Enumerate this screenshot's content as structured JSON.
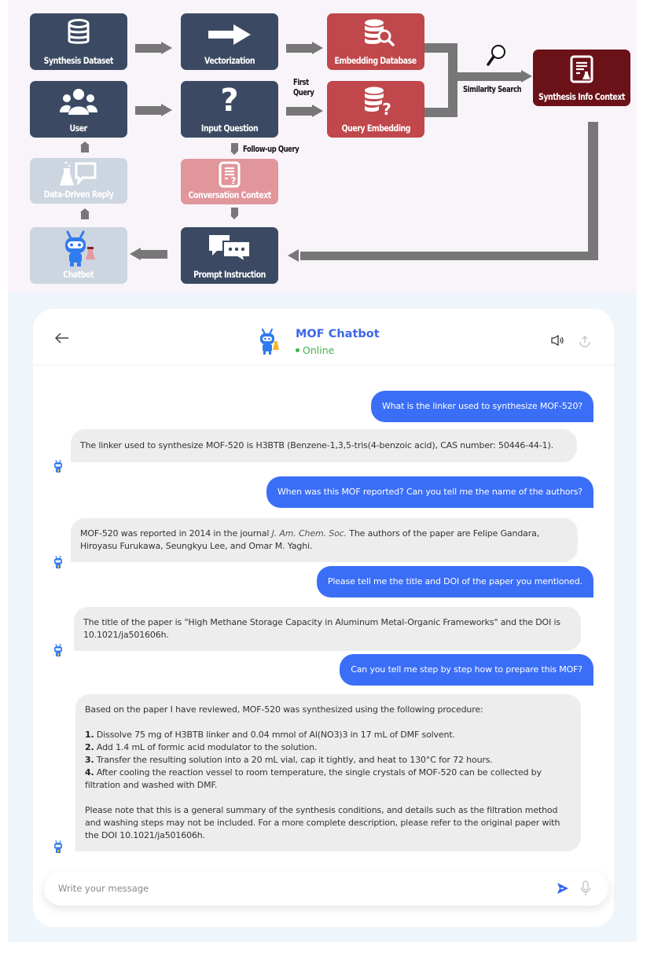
{
  "diagram": {
    "boxes": {
      "synthesis_dataset": "Synthesis Dataset",
      "vectorization": "Vectorization",
      "embedding_database": "Embedding Database",
      "user": "User",
      "input_question": "Input Question",
      "query_embedding": "Query Embedding",
      "synthesis_info_context": "Synthesis Info Context",
      "data_driven_reply": "Data-Driven Reply",
      "conversation_context": "Conversation Context",
      "chatbot": "Chatbot",
      "prompt_instruction": "Prompt Instruction"
    },
    "labels": {
      "first_query_line1": "First",
      "first_query_line2": "Query",
      "similarity_search": "Similarity Search",
      "follow_up_query": "Follow-up Query"
    },
    "colors": {
      "navy": "#3b4a62",
      "red": "#c0474b",
      "maroon": "#6b1118",
      "pale": "#cdd5e0",
      "pink": "#e0969b",
      "connector": "#777777"
    }
  },
  "chat": {
    "header": {
      "back_icon": "arrow-left-icon",
      "title": "MOF Chatbot",
      "status": "Online",
      "speaker_icon": "speaker-icon",
      "upload_icon": "upload-icon"
    },
    "messages": [
      {
        "role": "user",
        "text": "What is the linker used to synthesize MOF-520?"
      },
      {
        "role": "bot",
        "text": "The linker used to synthesize MOF-520 is H3BTB (Benzene-1,3,5-tris(4-benzoic acid), CAS number: 50446-44-1)."
      },
      {
        "role": "user",
        "text": "When was this MOF reported? Can you tell me the name of the authors?"
      },
      {
        "role": "bot",
        "text_before": "MOF-520 was reported in 2014 in the journal ",
        "journal": "J. Am. Chem. Soc.",
        "text_after": " The authors of the paper are Felipe Gandara, Hiroyasu Furukawa, Seungkyu Lee, and Omar M. Yaghi."
      },
      {
        "role": "user",
        "text": "Please tell me the title and DOI of the paper you mentioned."
      },
      {
        "role": "bot",
        "text": "The title of the paper is \"High Methane Storage Capacity in Aluminum Metal-Organic Frameworks\" and the DOI is 10.1021/ja501606h."
      },
      {
        "role": "user",
        "text": "Can you tell me step by step how to prepare this MOF?"
      },
      {
        "role": "bot",
        "intro": "Based on the paper I have reviewed, MOF-520 was synthesized using the following procedure:",
        "steps": [
          {
            "num": "1.",
            "text": " Dissolve 75 mg of H3BTB linker and 0.04 mmol of Al(NO3)3 in 17 mL of DMF solvent."
          },
          {
            "num": "2.",
            "text": " Add 1.4 mL of formic acid modulator to the solution."
          },
          {
            "num": "3.",
            "text": " Transfer the resulting solution into a 20 mL vial, cap it tightly, and heat to 130°C for 72 hours."
          },
          {
            "num": "4.",
            "text": " After cooling the reaction vessel to room temperature, the single crystals of MOF-520 can be collected by filtration and washed with DMF."
          }
        ],
        "note": "Please note that this is a general summary of the synthesis conditions, and details such as the filtration method and washing steps may not be included. For a more complete description, please refer to the original paper with the DOI 10.1021/ja501606h."
      }
    ],
    "composer": {
      "placeholder": "Write your message",
      "value": "",
      "send_icon": "send-icon",
      "mic_icon": "microphone-icon"
    },
    "colors": {
      "accent": "#3b6ef6",
      "title": "#3d67e8",
      "online": "#3db34a",
      "bot_bubble": "#ededed",
      "background": "#eef6fc"
    }
  }
}
